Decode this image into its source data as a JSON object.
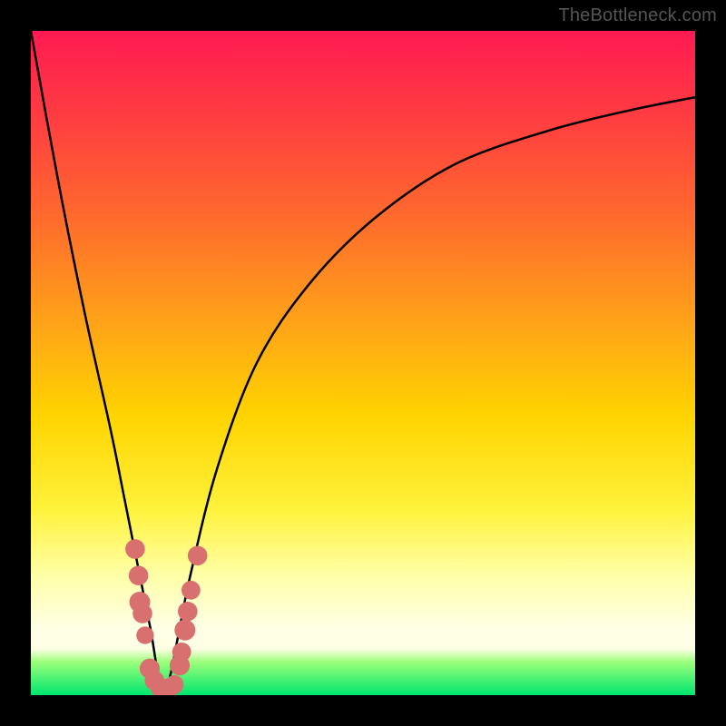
{
  "watermark": "TheBottleneck.com",
  "colors": {
    "frame": "#000000",
    "gradient_top": "#ff1a52",
    "gradient_mid": "#ffd400",
    "gradient_bottom": "#00e66e",
    "curve": "#000000",
    "dot": "#d97070"
  },
  "chart_data": {
    "type": "line",
    "title": "",
    "xlabel": "",
    "ylabel": "",
    "xlim": [
      0,
      100
    ],
    "ylim": [
      0,
      100
    ],
    "x_optimum": 20,
    "series": [
      {
        "name": "bottleneck-curve",
        "x": [
          0,
          4,
          8,
          12,
          14,
          16,
          18,
          19,
          20,
          21,
          22,
          24,
          28,
          34,
          42,
          52,
          64,
          78,
          90,
          100
        ],
        "y": [
          100,
          78,
          58,
          40,
          30,
          20,
          10,
          4,
          0,
          3,
          8,
          18,
          34,
          50,
          62,
          72,
          80,
          85,
          88,
          90
        ]
      }
    ],
    "scatter": {
      "name": "measured-points",
      "points": [
        {
          "x": 15.7,
          "y": 22.0,
          "r": 1.3
        },
        {
          "x": 16.2,
          "y": 18.0,
          "r": 1.3
        },
        {
          "x": 16.4,
          "y": 14.0,
          "r": 1.5
        },
        {
          "x": 16.8,
          "y": 12.3,
          "r": 1.3
        },
        {
          "x": 17.2,
          "y": 9.0,
          "r": 1.0
        },
        {
          "x": 17.9,
          "y": 4.0,
          "r": 1.4
        },
        {
          "x": 18.6,
          "y": 2.2,
          "r": 1.3
        },
        {
          "x": 19.5,
          "y": 1.0,
          "r": 1.2
        },
        {
          "x": 20.7,
          "y": 1.0,
          "r": 1.4
        },
        {
          "x": 21.6,
          "y": 1.6,
          "r": 1.2
        },
        {
          "x": 22.4,
          "y": 4.5,
          "r": 1.4
        },
        {
          "x": 22.7,
          "y": 6.5,
          "r": 1.2
        },
        {
          "x": 23.2,
          "y": 9.8,
          "r": 1.5
        },
        {
          "x": 23.6,
          "y": 12.6,
          "r": 1.3
        },
        {
          "x": 24.1,
          "y": 15.8,
          "r": 1.2
        },
        {
          "x": 25.1,
          "y": 21.0,
          "r": 1.3
        }
      ]
    }
  }
}
